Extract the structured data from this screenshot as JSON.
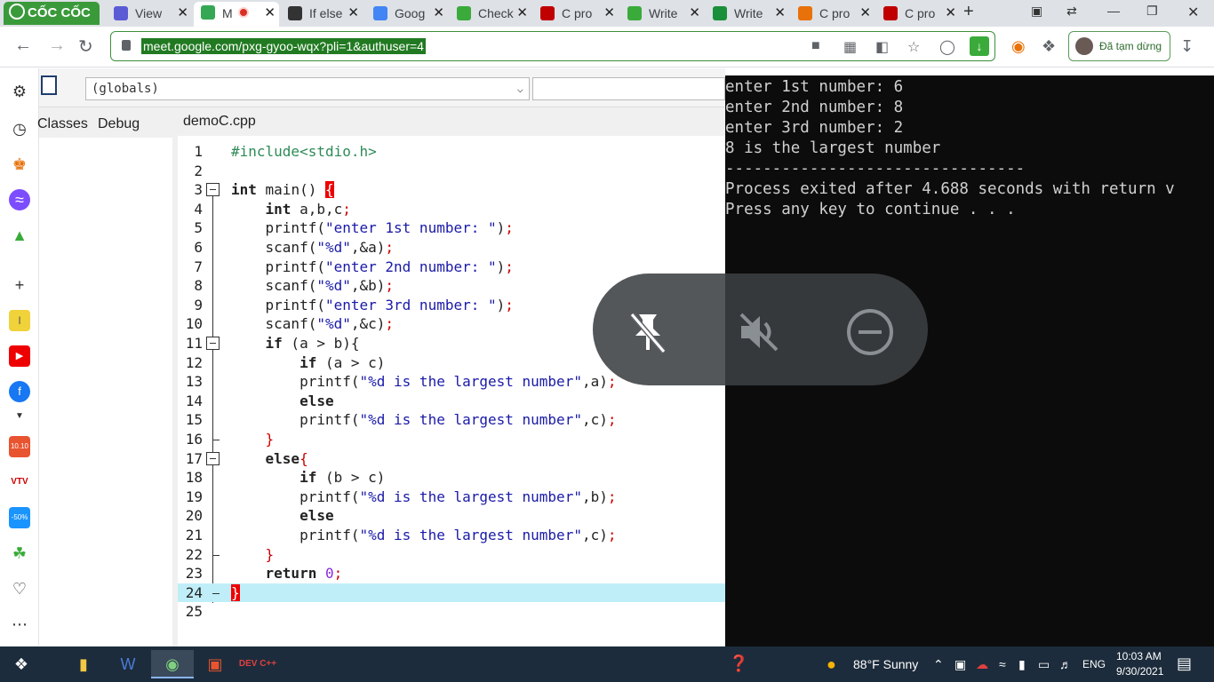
{
  "browser": {
    "brand": "CỐC CỐC",
    "tabs": [
      {
        "title": "View",
        "icon": "meet-icon",
        "fav_color": "#5b5bd6"
      },
      {
        "title": "M",
        "icon": "meet-icon",
        "fav_color": "#34a853",
        "active": true,
        "recording": true
      },
      {
        "title": "If else",
        "icon": "video-icon",
        "fav_color": "#333333"
      },
      {
        "title": "Goog",
        "icon": "translate-icon",
        "fav_color": "#4285f4"
      },
      {
        "title": "Check",
        "icon": "leaf-icon",
        "fav_color": "#3aab3a"
      },
      {
        "title": "C pro",
        "icon": "cup-icon",
        "fav_color": "#c00000"
      },
      {
        "title": "Write",
        "icon": "leaf-icon",
        "fav_color": "#3aab3a"
      },
      {
        "title": "Write",
        "icon": "check-icon",
        "fav_color": "#1a8f3a"
      },
      {
        "title": "C pro",
        "icon": "c-icon",
        "fav_color": "#e8710a"
      },
      {
        "title": "C pro",
        "icon": "cup-icon",
        "fav_color": "#c00000"
      }
    ],
    "url": "meet.google.com/pxg-gyoo-wqx?pli=1&authuser=4",
    "profile_status": "Đã tạm dừng"
  },
  "ide": {
    "scope_select": "(globals)",
    "left_tabs": [
      "Classes",
      "Debug"
    ],
    "file_tab": "demoC.cpp",
    "lines": [
      {
        "n": "1",
        "html": "<span class=\"pp\">#include&lt;stdio.h&gt;</span>"
      },
      {
        "n": "2",
        "html": ""
      },
      {
        "n": "3",
        "html": "<span class=\"kw\">int</span> main() <span class=\"brace-red\">{</span>"
      },
      {
        "n": "4",
        "html": "    <span class=\"kw\">int</span> a,b,c<span class=\"punc\">;</span>"
      },
      {
        "n": "5",
        "html": "    printf(<span class=\"str\">\"enter 1st number: \"</span>)<span class=\"punc\">;</span>"
      },
      {
        "n": "6",
        "html": "    scanf(<span class=\"str\">\"%d\"</span>,&amp;a)<span class=\"punc\">;</span>"
      },
      {
        "n": "7",
        "html": "    printf(<span class=\"str\">\"enter 2nd number: \"</span>)<span class=\"punc\">;</span>"
      },
      {
        "n": "8",
        "html": "    scanf(<span class=\"str\">\"%d\"</span>,&amp;b)<span class=\"punc\">;</span>"
      },
      {
        "n": "9",
        "html": "    printf(<span class=\"str\">\"enter 3rd number: \"</span>)<span class=\"punc\">;</span>"
      },
      {
        "n": "10",
        "html": "    scanf(<span class=\"str\">\"%d\"</span>,&amp;c)<span class=\"punc\">;</span>"
      },
      {
        "n": "11",
        "html": "    <span class=\"kw\">if</span> (a &gt; b){"
      },
      {
        "n": "12",
        "html": "        <span class=\"kw\">if</span> (a &gt; c)"
      },
      {
        "n": "13",
        "html": "        printf(<span class=\"str\">\"%d is the largest number\"</span>,a)<span class=\"punc\">;</span>"
      },
      {
        "n": "14",
        "html": "        <span class=\"kw\">else</span>"
      },
      {
        "n": "15",
        "html": "        printf(<span class=\"str\">\"%d is the largest number\"</span>,c)<span class=\"punc\">;</span>"
      },
      {
        "n": "16",
        "html": "    <span class=\"punc\">}</span>"
      },
      {
        "n": "17",
        "html": "    <span class=\"kw\">else</span><span class=\"punc\">{</span>"
      },
      {
        "n": "18",
        "html": "        <span class=\"kw\">if</span> (b &gt; c)"
      },
      {
        "n": "19",
        "html": "        printf(<span class=\"str\">\"%d is the largest number\"</span>,b)<span class=\"punc\">;</span>"
      },
      {
        "n": "20",
        "html": "        <span class=\"kw\">else</span>"
      },
      {
        "n": "21",
        "html": "        printf(<span class=\"str\">\"%d is the largest number\"</span>,c)<span class=\"punc\">;</span>"
      },
      {
        "n": "22",
        "html": "    <span class=\"punc\">}</span>"
      },
      {
        "n": "23",
        "html": "    <span class=\"kw\">return</span> <span class=\"num\">0</span><span class=\"punc\">;</span>"
      },
      {
        "n": "24",
        "html": "<span class=\"brace-red\">}</span>",
        "highlight": true
      },
      {
        "n": "25",
        "html": ""
      }
    ],
    "fold_lines": [
      "3",
      "11",
      "17"
    ]
  },
  "console": {
    "lines": [
      "enter 1st number: 6",
      "enter 2nd number: 8",
      "enter 3rd number: 2",
      "8 is the largest number",
      "--------------------------------",
      "Process exited after 4.688 seconds with return v",
      "Press any key to continue . . ."
    ]
  },
  "meet_overlay": {
    "buttons": [
      "unpin-icon",
      "mute-icon",
      "remove-icon"
    ]
  },
  "taskbar": {
    "weather": "88°F  Sunny",
    "lang": "ENG",
    "time": "10:03 AM",
    "date": "9/30/2021"
  }
}
